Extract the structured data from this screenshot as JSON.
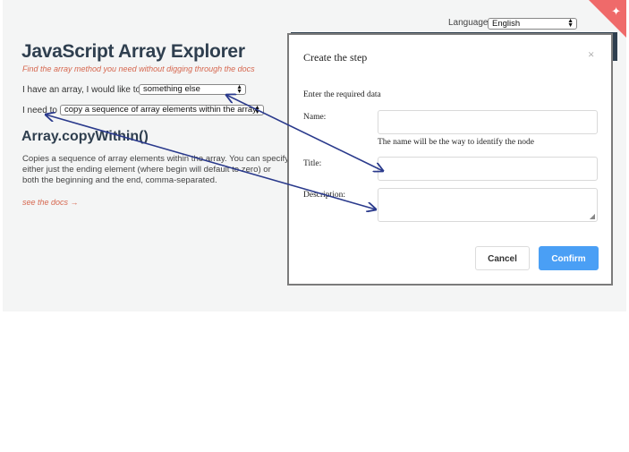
{
  "language": {
    "label": "Language:",
    "value": "English"
  },
  "app": {
    "title": "JavaScript Array Explorer",
    "subtitle": "Find the array method you need without digging through the docs",
    "line1_prefix": "I have an array, I would like to",
    "action_value": "something else",
    "line2_prefix": "I need to",
    "method_value": "copy a sequence of array elements within the array.",
    "method_heading": "Array.copyWithin()",
    "method_description": "Copies a sequence of array elements within the array. You can specify either just the ending element (where begin will default to zero) or both the beginning and the end, comma-separated.",
    "docs_link": "see the docs →"
  },
  "modal": {
    "title": "Create the step",
    "close": "×",
    "intro": "Enter the required data",
    "name_label": "Name:",
    "name_help": "The name will be the way to identify the node",
    "title_label": "Title:",
    "description_label": "Description:",
    "cancel_label": "Cancel",
    "confirm_label": "Confirm"
  },
  "colors": {
    "accent": "#4a9ff5",
    "heading": "#2f3f4f",
    "subtitle": "#d6674f",
    "arrow": "#2a3a8c",
    "ribbon": "#ef6a6a"
  }
}
